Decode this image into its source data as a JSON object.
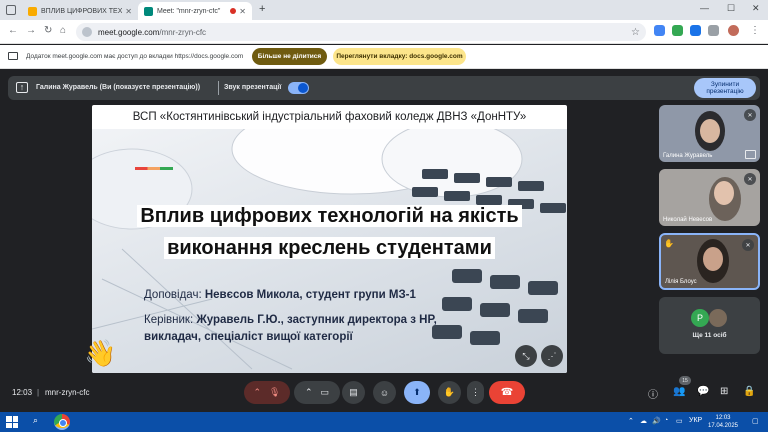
{
  "browser": {
    "tabs": [
      {
        "title": "ВПЛИВ ЦИФРОВИХ ТЕХН…",
        "favicon_color": "#f9ab00"
      },
      {
        "title": "Meet: \"mnr-zryn-cfc\"",
        "favicon_color": "#00897b"
      }
    ],
    "new_tab_icon": "plus-icon",
    "url": "meet.google.com/mnr-zryn-cfc",
    "url_host": "meet.google.com",
    "url_path": "/mnr-zryn-cfc"
  },
  "infobar": {
    "message": "Додаток meet.google.com має доступ до вкладки https://docs.google.com",
    "stop_sharing_label": "Більше не ділитися",
    "switch_tab_label": "Переглянути вкладку: docs.google.com"
  },
  "presentation_bar": {
    "presenter_text": "Галина Журавель (Ви (показуєте презентацію))",
    "sound_label": "Звук презентації",
    "sound_on": true,
    "stop_button_label": "Зупинити презентацію"
  },
  "slide": {
    "header": "ВСП «Костянтинівський індустріальний фаховий коледж ДВНЗ «ДонНТУ»",
    "title_line1": "Вплив цифрових технологій на якість",
    "title_line2": "виконання креслень студентами",
    "speaker_label": "Доповідач:",
    "speaker_value": "Невєсов Микола, студент групи МЗ-1",
    "supervisor_label": "Керівник:",
    "supervisor_value": "Журавель Г.Ю., заступник директора з НР,",
    "supervisor_value_line2": "викладач, спеціаліст вищої категорії"
  },
  "participants": [
    {
      "name": "Галина Журавель"
    },
    {
      "name": "Николай Невесов"
    },
    {
      "name": "Лілія Блоус"
    }
  ],
  "more_participants": {
    "label": "Ще 11 осіб",
    "avatar_letter": "P",
    "avatar_color": "#34a853"
  },
  "meeting": {
    "time": "12:03",
    "code": "mnr-zryn-cfc",
    "participant_count": "15"
  },
  "taskbar": {
    "tray_lang": "УКР",
    "clock_time": "12:03",
    "clock_date": "17.04.2025"
  },
  "colors": {
    "accent_blue": "#8ab4f8",
    "end_call_red": "#ea4335",
    "stop_sharing_brown": "#6f5b10",
    "switch_yellow": "#fce58b"
  }
}
